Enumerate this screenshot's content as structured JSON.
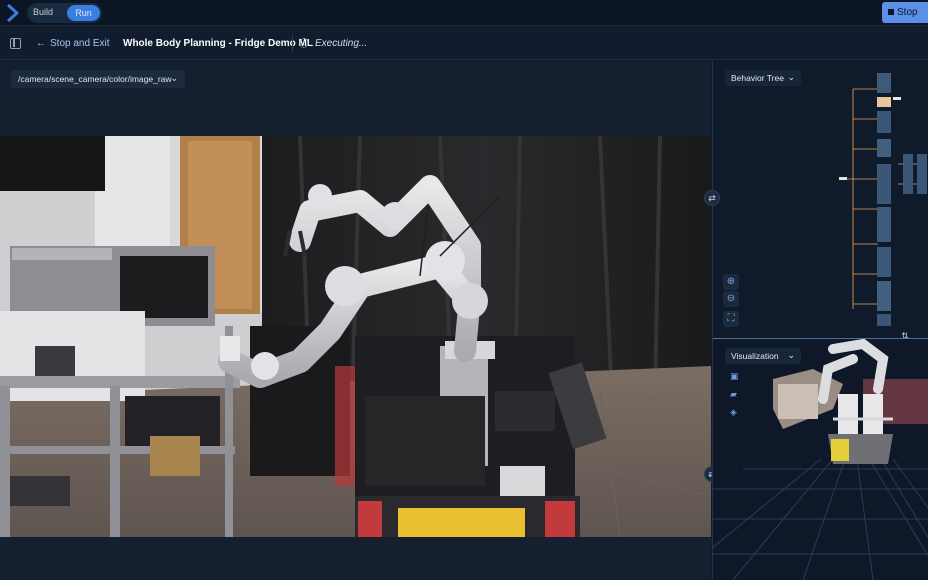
{
  "topbar": {
    "mode_build": "Build",
    "mode_run": "Run",
    "stop_label": "Stop"
  },
  "toolbar": {
    "back_label": "Stop and Exit",
    "objective_title": "Whole Body Planning - Fridge Demo ML",
    "status_text": "Executing..."
  },
  "main": {
    "topic": "/camera/scene_camera/color/image_raw"
  },
  "behavior_tree": {
    "view_label": "Behavior Tree"
  },
  "visualization": {
    "view_label": "Visualization"
  },
  "colors": {
    "accent": "#3a7ee0",
    "stop": "#5b8fe8",
    "background": "#0f1b2b"
  },
  "icons": [
    "chevron-logo-icon",
    "sidebar-toggle-icon",
    "arrow-left-icon",
    "spinner-icon",
    "chevron-down-icon",
    "zoom-in-icon",
    "zoom-out-icon",
    "fit-view-icon",
    "swap-panels-icon",
    "save-icon",
    "folder-icon",
    "cube-icon"
  ]
}
